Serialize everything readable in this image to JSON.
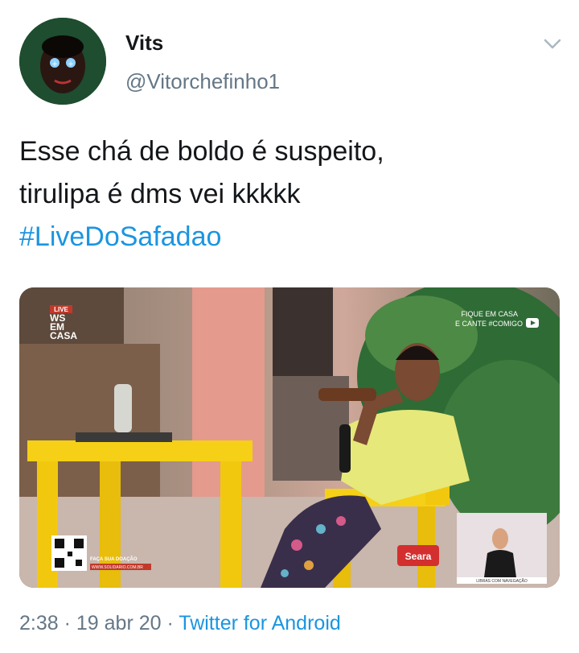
{
  "tweet": {
    "display_name": "Vits",
    "handle": "@Vitorchefinho1",
    "text_line1": "Esse chá de boldo é suspeito,",
    "text_line2": "tirulipa é dms vei kkkkk",
    "hashtag": "#LiveDoSafadao",
    "time": "2:38",
    "separator1": " · ",
    "date": "19 abr 20",
    "separator2": " · ",
    "source": "Twitter for Android"
  },
  "media": {
    "logo_live": "LIVE",
    "logo_line1": "WS",
    "logo_line2": "EM",
    "logo_line3": "CASA",
    "corner_line1": "FIQUE EM CASA",
    "corner_line2": "E CANTE #COMIGO",
    "donate_text": "FAÇA SUA DOAÇÃO",
    "donate_site": "WWW.SOLIDARIO.COM.BR",
    "sponsor": "Seara",
    "interpreter_caption": "LIBRAS COM NAVEGAÇÃO"
  },
  "colors": {
    "link": "#1b95e0",
    "secondary_text": "#657786",
    "avatar_bg": "#1e4d2f",
    "table_yellow": "#f5d016"
  }
}
